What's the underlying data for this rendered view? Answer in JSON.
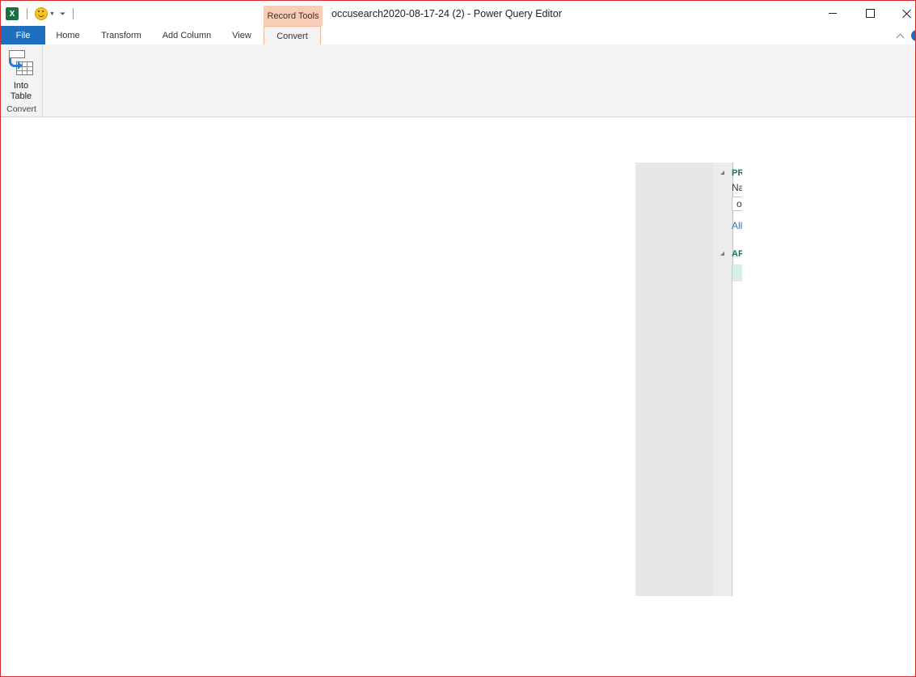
{
  "titlebar": {
    "title": "occusearch2020-08-17-24 (2) - Power Query Editor",
    "context_group": "Record Tools",
    "app_icon_letter": "X"
  },
  "tabs": {
    "file": "File",
    "home": "Home",
    "transform": "Transform",
    "add_column": "Add Column",
    "view": "View",
    "convert": "Convert"
  },
  "ribbon": {
    "into_table_label": "Into\nTable",
    "group_label": "Convert"
  },
  "query_settings": {
    "properties_title": "PR",
    "name_label": "Na",
    "name_value": "o",
    "all_properties_link": "All",
    "applied_steps_title": "AP"
  },
  "colors": {
    "file_tab": "#1f6fbf",
    "context_tab": "#f9cdb4",
    "window_border": "#d52b2b",
    "section_title": "#217346"
  }
}
